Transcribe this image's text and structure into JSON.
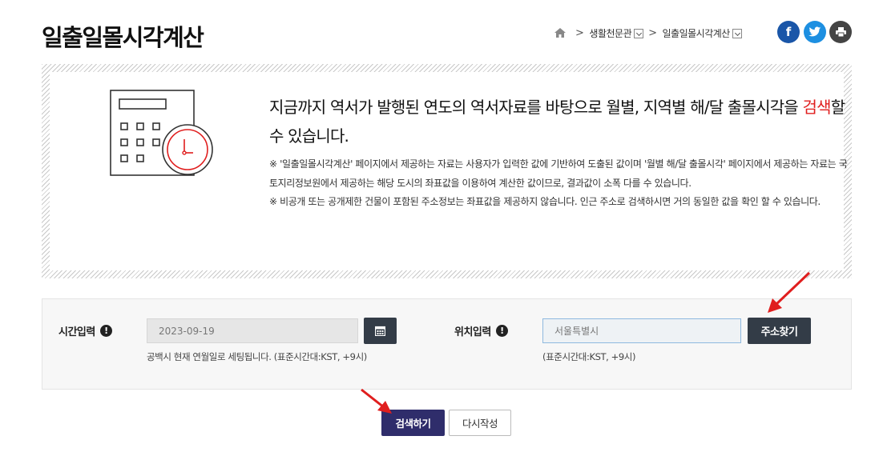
{
  "header": {
    "title": "일출일몰시각계산",
    "breadcrumb": {
      "item1": "생활천문관",
      "item2": "일출일몰시각계산"
    },
    "share": {
      "facebook": "f",
      "twitter": "t",
      "print": "print"
    }
  },
  "info": {
    "headline_part1": "지금까지 역서가 발행된 연도의 역서자료를 바탕으로 월별, 지역별 해/달 출몰시각을 ",
    "headline_highlight": "검색",
    "headline_part2": "할 수 있습니다.",
    "note1": "※ '일출일몰시각계산' 페이지에서 제공하는 자료는 사용자가 입력한 값에 기반하여 도출된 값이며 '월별 해/달 출몰시각' 페이지에서 제공하는 자료는 국토지리정보원에서 제공하는 해당 도시의 좌표값을 이용하여 계산한 값이므로, 결과값이 소폭 다를 수 있습니다.",
    "note2": "※ 비공개 또는 공개제한 건물이 포함된 주소정보는 좌표값을 제공하지 않습니다. 인근 주소로 검색하시면 거의 동일한 값을 확인 할 수 있습니다."
  },
  "form": {
    "time_label": "시간입력",
    "date_value": "2023-09-19",
    "time_hint": "공백시 현재 연월일로 세팅됩니다. (표준시간대:KST, +9시)",
    "location_label": "위치입력",
    "location_placeholder": "서울특별시",
    "location_hint": "(표준시간대:KST, +9시)",
    "address_button": "주소찾기",
    "help_icon": "!"
  },
  "actions": {
    "search": "검색하기",
    "reset": "다시작성"
  },
  "colors": {
    "accent_red": "#e01e1e",
    "navy": "#2f2d6b",
    "dark_button": "#333c47"
  }
}
